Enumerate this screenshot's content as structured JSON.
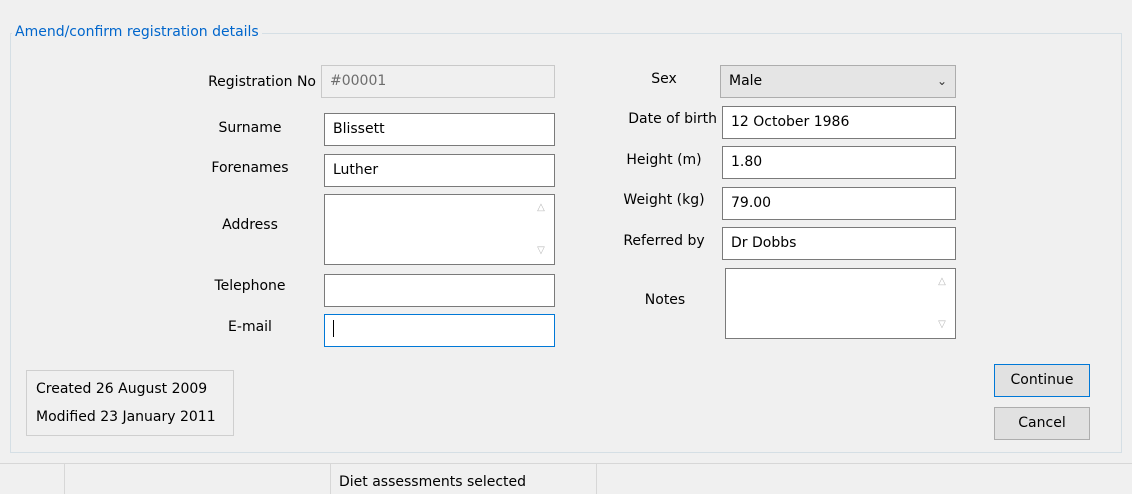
{
  "group": {
    "title": "Amend/confirm registration details"
  },
  "form": {
    "registration_no": {
      "label": "Registration No",
      "value": "#00001"
    },
    "surname": {
      "label": "Surname",
      "value": "Blissett"
    },
    "forenames": {
      "label": "Forenames",
      "value": "Luther"
    },
    "address": {
      "label": "Address",
      "value": ""
    },
    "telephone": {
      "label": "Telephone",
      "value": ""
    },
    "email": {
      "label": "E-mail",
      "value": ""
    },
    "sex": {
      "label": "Sex",
      "value": "Male"
    },
    "date_of_birth": {
      "label": "Date of birth",
      "value": "12 October 1986"
    },
    "height": {
      "label": "Height (m)",
      "value": "1.80"
    },
    "weight": {
      "label": "Weight (kg)",
      "value": "79.00"
    },
    "referred_by": {
      "label": "Referred by",
      "value": "Dr Dobbs"
    },
    "notes": {
      "label": "Notes",
      "value": ""
    }
  },
  "info": {
    "created": "Created 26 August 2009",
    "modified": "Modified 23 January 2011"
  },
  "buttons": {
    "continue": "Continue",
    "cancel": "Cancel"
  },
  "statusbar": {
    "text": "Diet assessments selected"
  }
}
